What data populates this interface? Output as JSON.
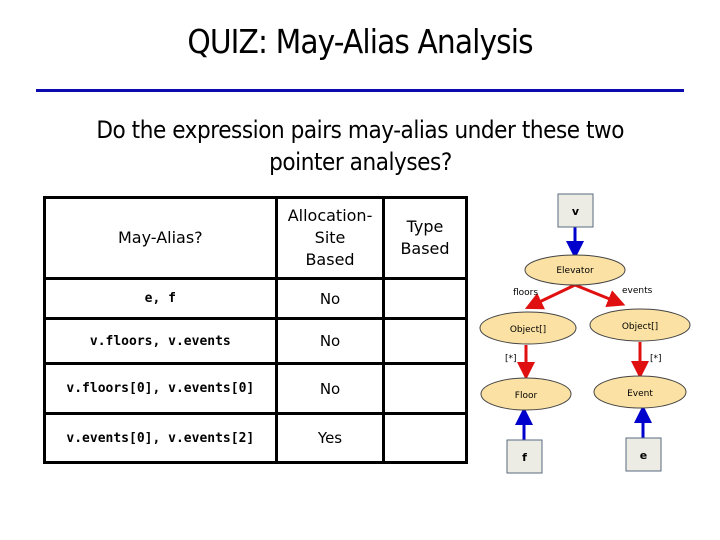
{
  "slide": {
    "title": "QUIZ: May-Alias Analysis",
    "question": "Do the expression pairs may-alias under these two pointer analyses?",
    "question_lines": [
      "Do the expression pairs may-alias under these two",
      "pointer analyses?"
    ],
    "accent_color": "#0b0bb0"
  },
  "table": {
    "headers": [
      "May-Alias?",
      "Allocation-Site Based",
      "Type Based"
    ],
    "header_lines": {
      "alloc": [
        "Allocation-",
        "Site",
        "Based"
      ],
      "type": [
        "Type",
        "Based"
      ]
    },
    "rows": [
      {
        "pair": "e, f",
        "allocation_site": "No",
        "type_based": ""
      },
      {
        "pair": "v.floors, v.events",
        "allocation_site": "No",
        "type_based": ""
      },
      {
        "pair": "v.floors[0], v.events[0]",
        "allocation_site": "No",
        "type_based": ""
      },
      {
        "pair": "v.events[0], v.events[2]",
        "allocation_site": "Yes",
        "type_based": ""
      }
    ]
  },
  "diagram": {
    "variables": {
      "v": "v",
      "f": "f",
      "e": "e"
    },
    "objects": {
      "elevator": "Elevator",
      "floors_array": "Object[]",
      "events_array": "Object[]",
      "floor": "Floor",
      "event": "Event"
    },
    "edge_labels": {
      "floors": "floors",
      "events": "events",
      "floors_elem": "[*]",
      "events_elem": "[*]"
    },
    "colors": {
      "var_fill": "#ececE4",
      "obj_fill": "#fbe2a4",
      "var_edge": "#0000cc",
      "field_edge": "#e01010"
    }
  }
}
